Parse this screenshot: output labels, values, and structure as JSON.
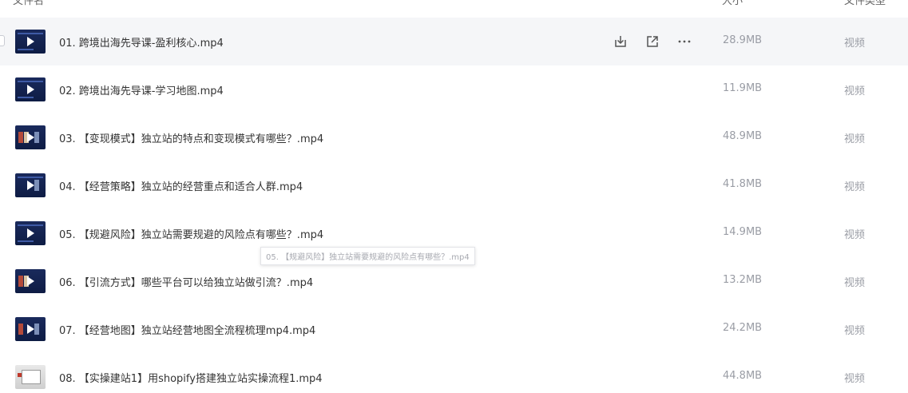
{
  "header": {
    "name": "文件名",
    "size": "大小",
    "type": "文件类型"
  },
  "files": [
    {
      "name": "01. 跨境出海先导课-盈利核心.mp4",
      "size": "28.9MB",
      "type": "视频"
    },
    {
      "name": "02. 跨境出海先导课-学习地图.mp4",
      "size": "11.9MB",
      "type": "视频"
    },
    {
      "name": "03. 【变现模式】独立站的特点和变现模式有哪些？.mp4",
      "size": "48.9MB",
      "type": "视频"
    },
    {
      "name": "04. 【经营策略】独立站的经营重点和适合人群.mp4",
      "size": "41.8MB",
      "type": "视频"
    },
    {
      "name": "05. 【规避风险】独立站需要规避的风险点有哪些？.mp4",
      "size": "14.9MB",
      "type": "视频"
    },
    {
      "name": "06. 【引流方式】哪些平台可以给独立站做引流？.mp4",
      "size": "13.2MB",
      "type": "视频"
    },
    {
      "name": "07. 【经营地图】独立站经营地图全流程梳理mp4.mp4",
      "size": "24.2MB",
      "type": "视频"
    },
    {
      "name": "08. 【实操建站1】用shopify搭建独立站实操流程1.mp4",
      "size": "44.8MB",
      "type": "视频"
    }
  ],
  "tooltip": "05. 【规避风险】独立站需要规避的风险点有哪些？.mp4",
  "icons": {
    "download": "download-icon",
    "share": "share-icon",
    "more": "more-icon"
  },
  "colors": {
    "hover_row": "#f5f6f8",
    "muted_text": "#9a9da5",
    "thumb_bg": "#1a2a5c"
  }
}
